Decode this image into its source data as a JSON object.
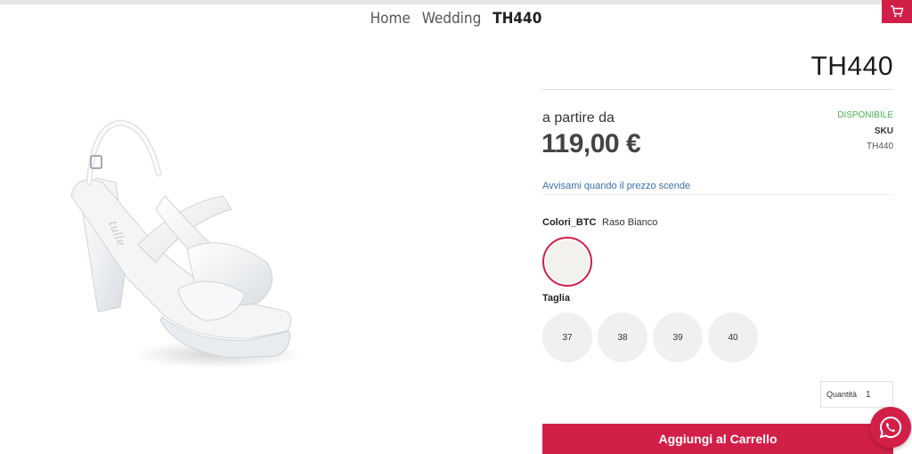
{
  "breadcrumb": {
    "items": [
      "Home",
      "Wedding"
    ],
    "current": "TH440"
  },
  "cart": {
    "icon": "cart-icon"
  },
  "product": {
    "title": "TH440",
    "from_label": "a partire da",
    "price": "119,00 €",
    "stock_status": "DISPONIBILE",
    "sku_label": "SKU",
    "sku_value": "TH440",
    "price_alert_link": "Avvisami quando il prezzo scende",
    "image": "white-satin-platform-sandal"
  },
  "color": {
    "label": "Colori_BTC",
    "value": "Raso Bianco",
    "swatch_color": "#f2f1ee"
  },
  "size": {
    "label": "Taglia",
    "options": [
      "37",
      "38",
      "39",
      "40"
    ]
  },
  "quantity": {
    "label": "Quantità",
    "value": "1"
  },
  "add_to_cart_label": "Aggiungi al Carrello",
  "whatsapp": {
    "icon": "whatsapp-icon"
  },
  "colors": {
    "accent": "#d21f48",
    "available": "#4caf50",
    "link": "#3b6fa8"
  }
}
